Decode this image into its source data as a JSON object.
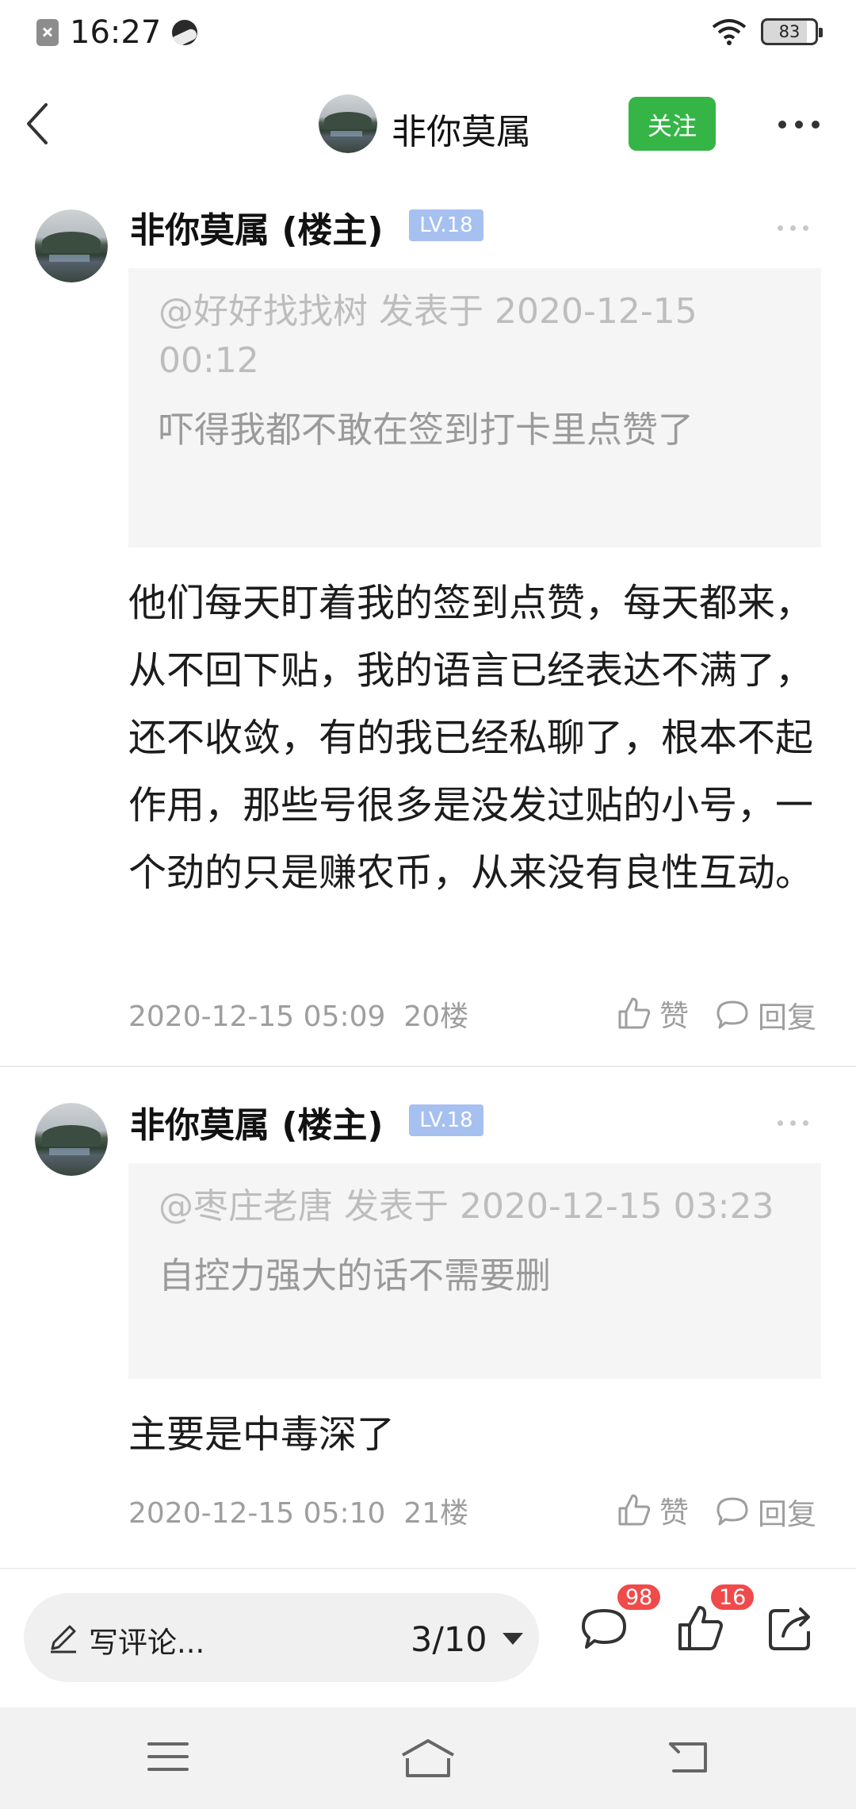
{
  "status_bar": {
    "time": "16:27",
    "battery": "83"
  },
  "header": {
    "title": "非你莫属",
    "follow_label": "关注"
  },
  "posts": [
    {
      "author": "非你莫属 (楼主)",
      "level": "LV.18",
      "quote_head": "@好好找找树 发表于 2020-12-15 00:12",
      "quote_body": "吓得我都不敢在签到打卡里点赞了",
      "content": "他们每天盯着我的签到点赞，每天都来，从不回下贴，我的语言已经表达不满了，还不收敛，有的我已经私聊了，根本不起作用，那些号很多是没发过贴的小号，一个劲的只是赚农币，从来没有良性互动。",
      "timestamp": "2020-12-15 05:09",
      "floor": "20楼",
      "like_label": "赞",
      "reply_label": "回复"
    },
    {
      "author": "非你莫属 (楼主)",
      "level": "LV.18",
      "quote_head": "@枣庄老唐 发表于 2020-12-15 03:23",
      "quote_body": "自控力强大的话不需要删",
      "content": "主要是中毒深了",
      "timestamp": "2020-12-15 05:10",
      "floor": "21楼",
      "like_label": "赞",
      "reply_label": "回复"
    }
  ],
  "bottom_bar": {
    "comment_placeholder": "写评论...",
    "pager": "3/10",
    "comment_count": "98",
    "like_count": "16"
  },
  "colors": {
    "accent_green": "#36b547",
    "badge_red": "#f04a4a",
    "level_blue": "#a6c0f0"
  },
  "icons": [
    "back-arrow-icon",
    "more-icon",
    "like-icon",
    "reply-icon",
    "pen-icon",
    "comment-icon",
    "thumb-up-icon",
    "share-icon",
    "menu-icon",
    "home-icon",
    "back-nav-icon"
  ]
}
